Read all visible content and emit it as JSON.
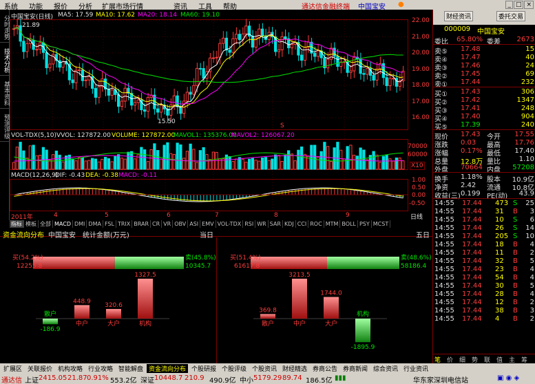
{
  "menu": {
    "items": [
      "系统",
      "功能",
      "报价",
      "分析",
      "扩展市场行情",
      "资讯",
      "工具",
      "帮助"
    ],
    "brand": "通达信金融终端",
    "stock_name": "中国宝安",
    "win_buttons": [
      "_",
      "□",
      "×"
    ]
  },
  "lefttabs": [
    "分时走势",
    "技术分析",
    "基本资料",
    "预测评级"
  ],
  "legend": {
    "title": "中国宝安(日线)",
    "ma5": "MA5: 17.59",
    "ma10": "MA10: 17.62",
    "ma20": "MA20: 18.14",
    "ma60": "MA60: 19.10",
    "high_mark": "21.89",
    "low_mark": "15.50",
    "vol_title": "VOL-TDX(5,10)",
    "vvol": "VVOL: 127872.00",
    "volume": "VOLUME: 127872.00",
    "mavol1": "MAVOL1: 135376.00",
    "mavol2": "MAVOL2: 126067.20",
    "macd_title": "MACD(12,26,9)",
    "dif": "DIF: -0.43",
    "dea": "DEA: -0.38",
    "macd": "MACD: -0.11",
    "x10": "X10",
    "year": "2011年",
    "s_mark": "S",
    "xticks": [
      "4",
      "5",
      "6",
      "7",
      "8",
      "9"
    ],
    "daily": "日线"
  },
  "price_axis": [
    "22.00",
    "21.00",
    "20.00",
    "19.00",
    "18.00",
    "17.00",
    "16.00"
  ],
  "vol_axis": [
    "70000",
    "60000"
  ],
  "macd_axis": [
    "1.00",
    "0.50",
    "0.00",
    "-0.50"
  ],
  "indextabs": [
    "指标",
    "模板",
    "全部",
    "MACD",
    "DMI",
    "DMA",
    "FSL",
    "TRIX",
    "BRAR",
    "CR",
    "VR",
    "OBV",
    "ASI",
    "EMV",
    "VOL-TDX",
    "RSI",
    "WR",
    "SAR",
    "KDJ",
    "CCI",
    "ROC",
    "MTM",
    "BOLL",
    "PSY",
    "MCST"
  ],
  "flow": {
    "head_title": "资金流向分布",
    "head_stock": "中国宝安",
    "head_unit": "统计金额(万元)",
    "left_period": "当日",
    "right_period": "五日",
    "left": {
      "buy_label": "买(54.2%)",
      "buy_value": "12255.8",
      "sell_label": "卖(45.8%)",
      "sell_value": "10345.7",
      "buy_pct": 54.2,
      "bars": [
        {
          "name": "散户",
          "value": -186.9,
          "label": "-186.9"
        },
        {
          "name": "中户",
          "value": 448.9,
          "label": "448.9"
        },
        {
          "name": "大户",
          "value": 320.6,
          "label": "320.6"
        },
        {
          "name": "机构",
          "value": 1327.5,
          "label": "1327.5"
        }
      ]
    },
    "right": {
      "buy_label": "买(51.4%)",
      "buy_value": "61617.8",
      "sell_label": "卖(48.6%)",
      "sell_value": "58186.4",
      "buy_pct": 51.4,
      "bars": [
        {
          "name": "散户",
          "value": 369.8,
          "label": "369.8"
        },
        {
          "name": "中户",
          "value": 3213.5,
          "label": "3213.5"
        },
        {
          "name": "大户",
          "value": 1744.0,
          "label": "1744.0"
        },
        {
          "name": "机构",
          "value": -1895.9,
          "label": "-1895.9"
        }
      ]
    }
  },
  "rpanel": {
    "btn1": "财经资讯",
    "btn2": "委托交易",
    "code": "000009",
    "name": "中国宝安",
    "weibi_label": "委比",
    "weibi_value": "65.80%",
    "weicha_label": "委差",
    "weicha_value": "2673",
    "asks": [
      {
        "label": "卖⑤",
        "price": "17.48",
        "vol": "15"
      },
      {
        "label": "卖④",
        "price": "17.47",
        "vol": "40"
      },
      {
        "label": "卖③",
        "price": "17.46",
        "vol": "24"
      },
      {
        "label": "卖②",
        "price": "17.45",
        "vol": "69"
      },
      {
        "label": "卖①",
        "price": "17.44",
        "vol": "232"
      }
    ],
    "bids": [
      {
        "label": "买①",
        "price": "17.43",
        "vol": "306"
      },
      {
        "label": "买②",
        "price": "17.42",
        "vol": "1347"
      },
      {
        "label": "买③",
        "price": "17.41",
        "vol": "248"
      },
      {
        "label": "买④",
        "price": "17.40",
        "vol": "904"
      },
      {
        "label": "买⑤",
        "price": "17.39",
        "vol": "240"
      }
    ],
    "quote": [
      {
        "l1": "现价",
        "v1": "17.43",
        "c1": "red",
        "l2": "今开",
        "v2": "17.55",
        "c2": "red"
      },
      {
        "l1": "涨跌",
        "v1": "0.03",
        "c1": "red",
        "l2": "最高",
        "v2": "17.76",
        "c2": "red"
      },
      {
        "l1": "涨幅",
        "v1": "0.17%",
        "c1": "red",
        "l2": "最低",
        "v2": "17.40",
        "c2": "wht"
      },
      {
        "l1": "总量",
        "v1": "12.8万",
        "c1": "yel",
        "l2": "量比",
        "v2": "1.10",
        "c2": "wht"
      },
      {
        "l1": "外盘",
        "v1": "70664",
        "c1": "red",
        "l2": "内盘",
        "v2": "57208",
        "c2": "grn"
      }
    ],
    "quote2": [
      {
        "l1": "换手",
        "v1": "1.18%",
        "l2": "股本",
        "v2": "10.9亿"
      },
      {
        "l1": "净资",
        "v1": "2.42",
        "l2": "流通",
        "v2": "10.8亿"
      },
      {
        "l1": "收益(三)",
        "v1": "0.199",
        "l2": "PE(动)",
        "v2": "43.9"
      }
    ],
    "ticks": [
      {
        "t": "14:55",
        "p": "17.44",
        "v": "473",
        "d": "S",
        "n": "25"
      },
      {
        "t": "14:55",
        "p": "17.44",
        "v": "31",
        "d": "B",
        "n": "3"
      },
      {
        "t": "14:55",
        "p": "17.44",
        "v": "10",
        "d": "S",
        "n": "6"
      },
      {
        "t": "14:55",
        "p": "17.44",
        "v": "26",
        "d": "S",
        "n": "14"
      },
      {
        "t": "14:55",
        "p": "17.44",
        "v": "205",
        "d": "S",
        "n": "10"
      },
      {
        "t": "14:55",
        "p": "17.44",
        "v": "18",
        "d": "B",
        "n": "4"
      },
      {
        "t": "14:55",
        "p": "17.44",
        "v": "11",
        "d": "B",
        "n": "2"
      },
      {
        "t": "14:55",
        "p": "17.44",
        "v": "32",
        "d": "B",
        "n": "5"
      },
      {
        "t": "14:55",
        "p": "17.44",
        "v": "23",
        "d": "B",
        "n": "4"
      },
      {
        "t": "14:55",
        "p": "17.44",
        "v": "54",
        "d": "B",
        "n": "4"
      },
      {
        "t": "14:55",
        "p": "17.44",
        "v": "30",
        "d": "B",
        "n": "5"
      },
      {
        "t": "14:55",
        "p": "17.44",
        "v": "28",
        "d": "B",
        "n": "4"
      },
      {
        "t": "14:55",
        "p": "17.44",
        "v": "12",
        "d": "B",
        "n": "2"
      },
      {
        "t": "14:55",
        "p": "17.44",
        "v": "38",
        "d": "B",
        "n": "3"
      },
      {
        "t": "14:55",
        "p": "17.44",
        "v": "4",
        "d": "B",
        "n": "2"
      }
    ],
    "bottom_tabs": [
      "笔",
      "价",
      "细",
      "势",
      "联",
      "值",
      "主",
      "筹"
    ]
  },
  "bottomtabs": [
    "扩展区",
    "关联报价",
    "机构攻略",
    "行业攻略",
    "智能解盘",
    "资金流向分布",
    "个股研报",
    "个股评级",
    "个股资讯",
    "财经精选",
    "券商公告",
    "券商新闻",
    "综合资讯",
    "行业资讯"
  ],
  "status": {
    "brand": "通达信",
    "sh_label": "上证",
    "sh_value": "2415.05",
    "sh_change": "21.87",
    "sh_pct": "0.91%",
    "sh_amount": "553.2亿",
    "sz_label": "深证",
    "sz_value": "10448.7",
    "sz_change": "210.9",
    "sz_amount": "490.9亿",
    "zx_label": "中小",
    "zx_value": "5179.29",
    "zx_change": "89.74",
    "zx_amount": "186.5亿",
    "station": "华东家深圳电信站"
  }
}
